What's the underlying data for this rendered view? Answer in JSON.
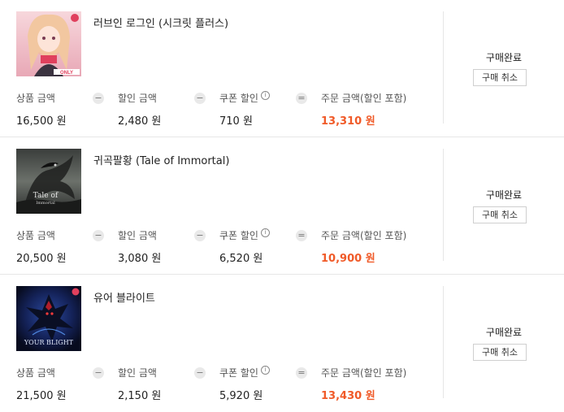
{
  "orders": [
    {
      "title": "러브인 로그인 (시크릿 플러스)",
      "thumbnail": "love-in-login-cover",
      "product_label": "상품 금액",
      "product_price": "16,500 원",
      "discount_label": "할인 금액",
      "discount_price": "2,480 원",
      "coupon_label": "쿠폰 할인",
      "coupon_price": "710 원",
      "total_label": "주문 금액(할인 포함)",
      "total_price": "13,310 원",
      "status": "구매완료",
      "cancel_label": "구매 취소"
    },
    {
      "title": "귀곡팔황 (Tale of Immortal)",
      "thumbnail": "tale-of-immortal-cover",
      "product_label": "상품 금액",
      "product_price": "20,500 원",
      "discount_label": "할인 금액",
      "discount_price": "3,080 원",
      "coupon_label": "쿠폰 할인",
      "coupon_price": "6,520 원",
      "total_label": "주문 금액(할인 포함)",
      "total_price": "10,900 원",
      "status": "구매완료",
      "cancel_label": "구매 취소"
    },
    {
      "title": "유어 블라이트",
      "thumbnail": "your-blight-cover",
      "product_label": "상품 금액",
      "product_price": "21,500 원",
      "discount_label": "할인 금액",
      "discount_price": "2,150 원",
      "coupon_label": "쿠폰 할인",
      "coupon_price": "5,920 원",
      "total_label": "주문 금액(할인 포함)",
      "total_price": "13,430 원",
      "status": "구매완료",
      "cancel_label": "구매 취소"
    }
  ],
  "thumb_text": {
    "cover1_badge": "ONLY",
    "cover2_line1": "Tale of",
    "cover2_line2": "Immortal",
    "cover3_text": "YOUR BLIGHT"
  },
  "operators": {
    "minus": "−",
    "equals": "="
  },
  "colors": {
    "accent": "#f05a28",
    "divider": "#e6e6e6"
  },
  "icons": {
    "coupon_info": "info-icon"
  }
}
